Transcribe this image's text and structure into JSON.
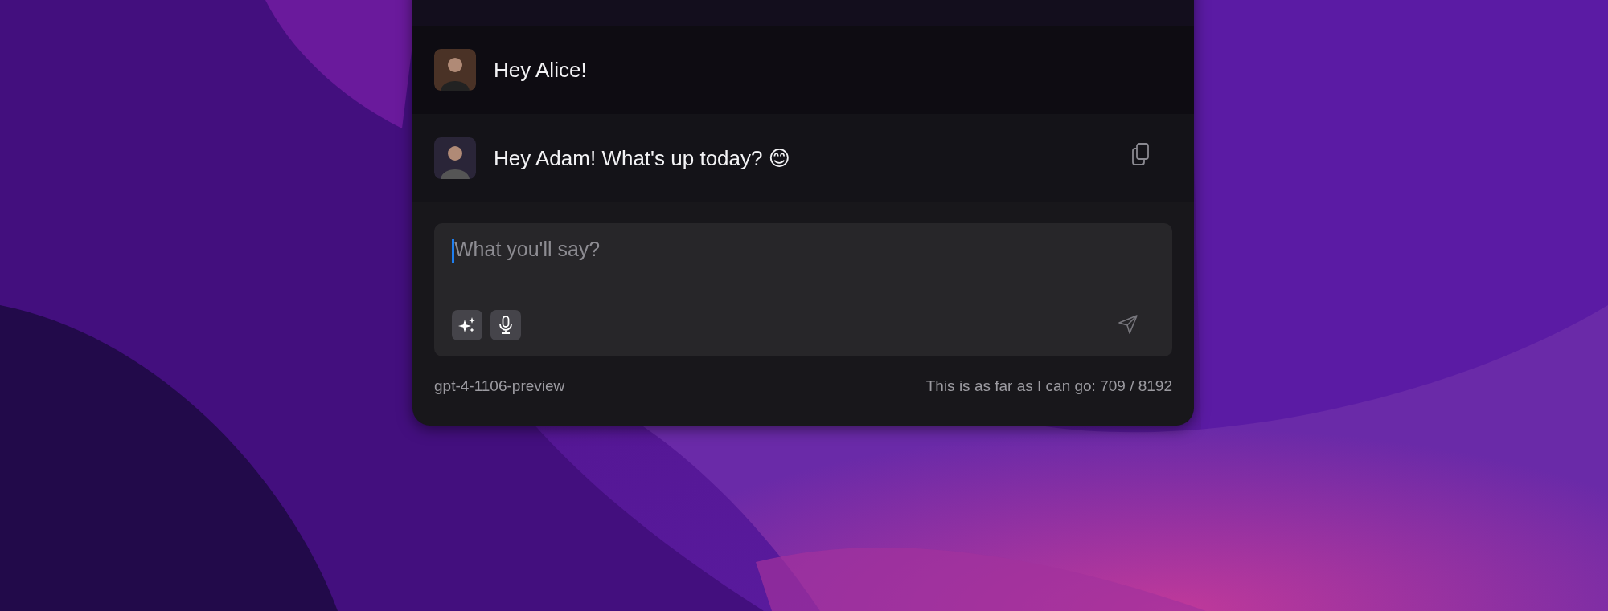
{
  "messages": [
    {
      "kind": "user",
      "text": "Hey Alice!",
      "hovered": false
    },
    {
      "kind": "assistant",
      "text": "Hey Adam! What's up today? 😊",
      "hovered": true
    }
  ],
  "composer": {
    "placeholder": "What you'll say?"
  },
  "footer": {
    "model": "gpt-4-1106-preview",
    "usage": "This is as far as I can go: 709 / 8192"
  }
}
